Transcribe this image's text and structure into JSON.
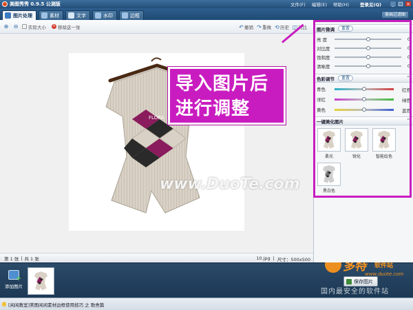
{
  "titlebar": {
    "title": "美图秀秀 0.9.5 公测版",
    "menus": [
      "文件(F)",
      "编辑(E)",
      "帮助(H)"
    ],
    "login": "登录见(Q)",
    "buttons": [
      "_",
      "□",
      "×"
    ]
  },
  "tabs": [
    {
      "label": "图片处理",
      "active": true
    },
    {
      "label": "素材",
      "active": false
    },
    {
      "label": "文字",
      "active": false
    },
    {
      "label": "水印",
      "active": false
    },
    {
      "label": "边框",
      "active": false
    }
  ],
  "filter_tab": "美画过滤图",
  "toolbar": {
    "actual_size": "实际大小",
    "remove": "移除这一张",
    "undo": "撤销",
    "redo": "重做",
    "history": "历史",
    "compare": "对比"
  },
  "canvas": {
    "watermark": "www.DuoTe.com",
    "product_brand": "FLORA"
  },
  "annotation": {
    "line1": "导入图片后",
    "line2": "进行调整"
  },
  "status": {
    "page": "第 1 张",
    "total": "共 1 张",
    "filename": "10.jpg",
    "size": "尺寸：500x500"
  },
  "filmstrip": {
    "add_label": "添加图片",
    "save_label": "保存图片"
  },
  "bottom": {
    "tip": "[闲闲教室]美图闲闲素材边框使用技巧 之 歌舍篇"
  },
  "site_watermark": {
    "big": "多特",
    "mid": "软件站",
    "url": "www.duote.com",
    "sub": "国内最安全的软件站"
  },
  "panel": {
    "fine_tune": {
      "title": "图片微调",
      "reset": "重置",
      "rows": [
        {
          "label": "亮  度",
          "value": "0",
          "position": 0.5
        },
        {
          "label": "对比度",
          "value": "0",
          "position": 0.5
        },
        {
          "label": "饱和度",
          "value": "0",
          "position": 0.5
        },
        {
          "label": "清晰度",
          "value": "0",
          "position": 0.5
        }
      ]
    },
    "color_adjust": {
      "title": "色彩调节",
      "reset": "重置",
      "rows": [
        {
          "left": "青色",
          "right": "红色",
          "colors": [
            "#2ab0c4",
            "#d43b3b"
          ],
          "position": 0.5
        },
        {
          "left": "洋红",
          "right": "绿色",
          "colors": [
            "#c93ad0",
            "#3bba3b"
          ],
          "position": 0.5
        },
        {
          "left": "黄色",
          "right": "蓝色",
          "colors": [
            "#e8d236",
            "#3b5cd4"
          ],
          "position": 0.5
        }
      ]
    },
    "presets": {
      "title": "一键美化图片",
      "items": [
        "柔光",
        "锐化",
        "智能绘色",
        "黑白色"
      ]
    }
  },
  "colors": {
    "accent": "#c91cc0",
    "title_bar": "#2e5f8f"
  }
}
